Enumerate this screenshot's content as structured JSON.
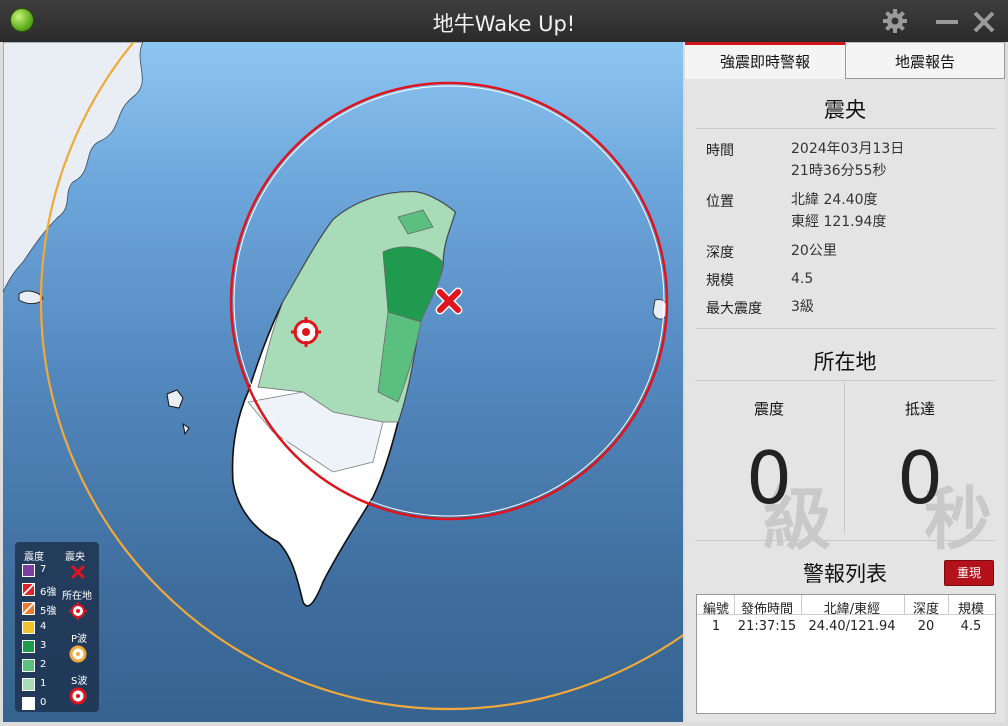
{
  "window": {
    "title": "地牛Wake Up!"
  },
  "tabs": [
    {
      "label": "強震即時警報"
    },
    {
      "label": "地震報告"
    }
  ],
  "epicenter": {
    "title": "震央",
    "time_label": "時間",
    "time_date": "2024年03月13日",
    "time_clock": "21時36分55秒",
    "pos_label": "位置",
    "lat": "北緯 24.40度",
    "lon": "東經 121.94度",
    "depth_label": "深度",
    "depth": "20公里",
    "mag_label": "規模",
    "mag": "4.5",
    "maxint_label": "最大震度",
    "maxint": "3級"
  },
  "location": {
    "title": "所在地",
    "intensity_label": "震度",
    "intensity": "0",
    "intensity_unit": "級",
    "arrival_label": "抵達",
    "arrival": "0",
    "arrival_unit": "秒"
  },
  "alerts": {
    "title": "警報列表",
    "replay_label": "重現",
    "headers": [
      "編號",
      "發佈時間",
      "北緯/東經",
      "深度",
      "規模"
    ],
    "rows": [
      [
        "1",
        "21:37:15",
        "24.40/121.94",
        "20",
        "4.5"
      ]
    ]
  },
  "legend": {
    "intensity_header": "震度",
    "epicenter_header": "震央",
    "location_label": "所在地",
    "pwave_label": "P波",
    "swave_label": "S波",
    "levels": [
      {
        "label": "7",
        "color": "#7b3fa0"
      },
      {
        "label": "6強",
        "color": "#e0232a"
      },
      {
        "label": "5強",
        "color": "#f07a2c"
      },
      {
        "label": "4",
        "color": "#f3c12e"
      },
      {
        "label": "3",
        "color": "#1f9a4e"
      },
      {
        "label": "2",
        "color": "#5bbf7f"
      },
      {
        "label": "1",
        "color": "#a8dcb8"
      },
      {
        "label": "0",
        "color": "#ffffff"
      }
    ]
  },
  "colors": {
    "accent": "#d2161c",
    "swave": "#e0141c",
    "pwave": "#f0a93a"
  }
}
